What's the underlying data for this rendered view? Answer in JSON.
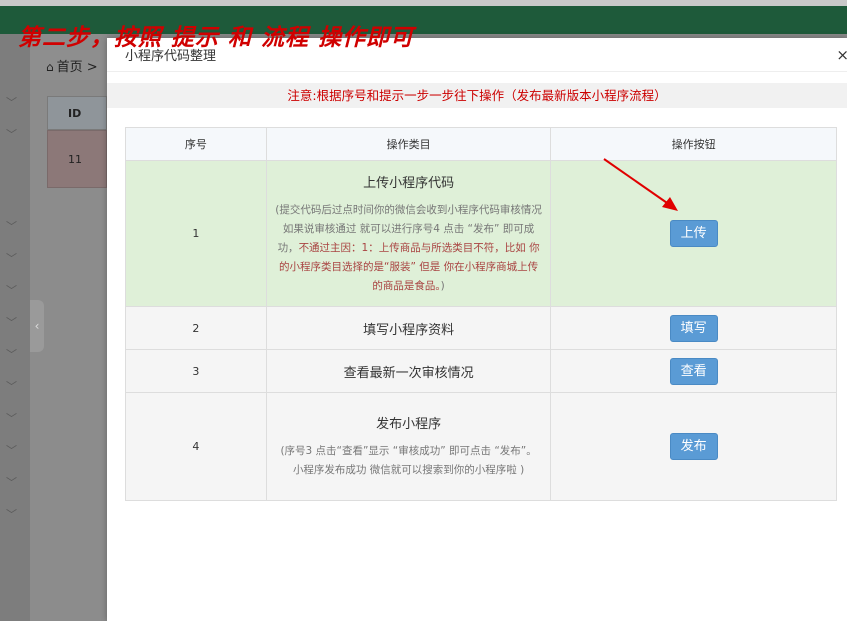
{
  "overlay_instruction": "第二步，按照 提示 和 流程 操作即可",
  "breadcrumb": {
    "home_label": "首页 >"
  },
  "bg_table": {
    "header": "ID",
    "row_value": "11"
  },
  "modal": {
    "title": "小程序代码整理",
    "close_symbol": "×",
    "notice": "注意:根据序号和提示一步一步往下操作（发布最新版本小程序流程）",
    "columns": [
      "序号",
      "操作类目",
      "操作按钮"
    ],
    "rows": [
      {
        "no": "1",
        "title": "上传小程序代码",
        "desc_gray": "(提交代码后过点时间你的微信会收到小程序代码审核情况 如果说审核通过 就可以进行序号4 点击 “发布” 即可成功，",
        "desc_red": "不通过主因：1：上传商品与所选类目不符，比如 你的小程序类目选择的是“服装” 但是 你在小程序商城上传的商品是食品。",
        "desc_end": ")",
        "button": "上传"
      },
      {
        "no": "2",
        "title": "填写小程序资料",
        "button": "填写"
      },
      {
        "no": "3",
        "title": "查看最新一次审核情况",
        "button": "查看"
      },
      {
        "no": "4",
        "title": "发布小程序",
        "desc_gray": "(序号3 点击“查看”显示 “审核成功” 即可点击 “发布”。 小程序发布成功 微信就可以搜索到你的小程序啦 )",
        "button": "发布"
      }
    ]
  },
  "colors": {
    "button": "#5a9bd5",
    "highlight_row": "#dff0d8",
    "notice_text": "#cc0000",
    "overlay_text": "#d00000"
  }
}
